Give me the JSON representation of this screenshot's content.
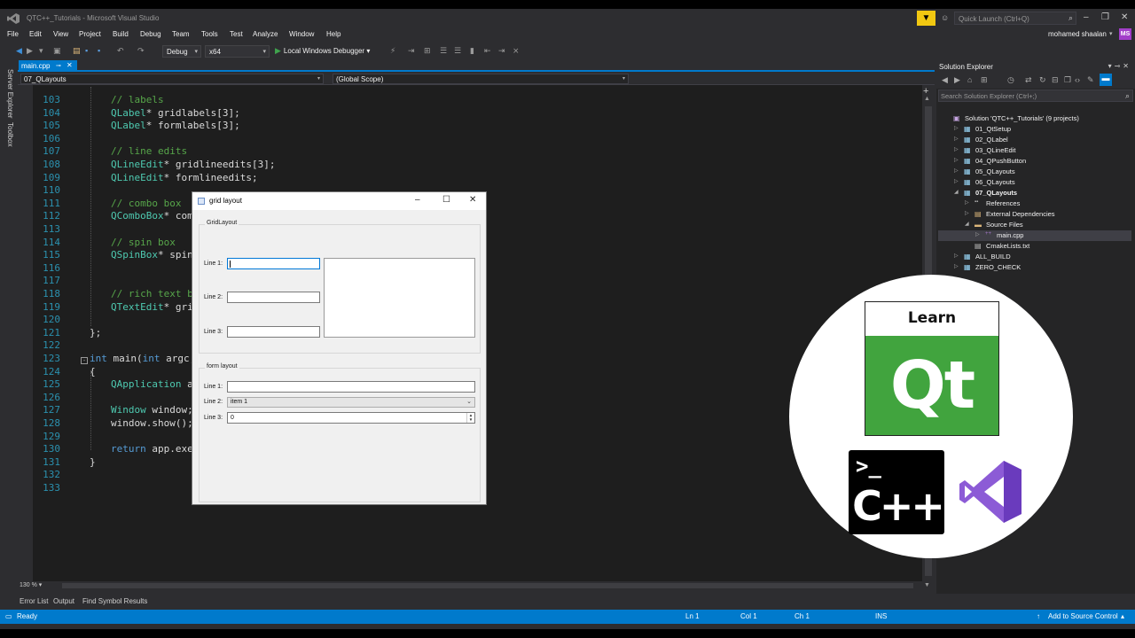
{
  "window": {
    "title": "QTC++_Tutorials - Microsoft Visual Studio",
    "quick_launch_placeholder": "Quick Launch (Ctrl+Q)",
    "user_name": "mohamed shaalan",
    "user_initials": "MS"
  },
  "menu": [
    "File",
    "Edit",
    "View",
    "Project",
    "Build",
    "Debug",
    "Team",
    "Tools",
    "Test",
    "Analyze",
    "Window",
    "Help"
  ],
  "toolbar": {
    "config": "Debug",
    "platform": "x64",
    "debugger": "Local Windows Debugger"
  },
  "side_tabs": [
    "Server Explorer",
    "Toolbox"
  ],
  "editor": {
    "tab_label": "main.cpp",
    "project_scope": "07_QLayouts",
    "scope": "(Global Scope)",
    "zoom": "130 %",
    "lines": [
      {
        "n": "103",
        "parts": [
          {
            "t": "// labels",
            "c": "cmt"
          }
        ]
      },
      {
        "n": "104",
        "parts": [
          {
            "t": "QLabel",
            "c": "ty"
          },
          {
            "t": "* gridlabels[3];",
            "c": "vr"
          }
        ]
      },
      {
        "n": "105",
        "parts": [
          {
            "t": "QLabel",
            "c": "ty"
          },
          {
            "t": "* formlabels[3];",
            "c": "vr"
          }
        ]
      },
      {
        "n": "106",
        "parts": []
      },
      {
        "n": "107",
        "parts": [
          {
            "t": "// line edits",
            "c": "cmt"
          }
        ]
      },
      {
        "n": "108",
        "parts": [
          {
            "t": "QLineEdit",
            "c": "ty"
          },
          {
            "t": "* gridlineedits[3];",
            "c": "vr"
          }
        ]
      },
      {
        "n": "109",
        "parts": [
          {
            "t": "QLineEdit",
            "c": "ty"
          },
          {
            "t": "* formlineedits;",
            "c": "vr"
          }
        ]
      },
      {
        "n": "110",
        "parts": []
      },
      {
        "n": "111",
        "parts": [
          {
            "t": "// combo box",
            "c": "cmt"
          }
        ]
      },
      {
        "n": "112",
        "parts": [
          {
            "t": "QComboBox",
            "c": "ty"
          },
          {
            "t": "* comb",
            "c": "vr"
          }
        ]
      },
      {
        "n": "113",
        "parts": []
      },
      {
        "n": "114",
        "parts": [
          {
            "t": "// spin box",
            "c": "cmt"
          }
        ]
      },
      {
        "n": "115",
        "parts": [
          {
            "t": "QSpinBox",
            "c": "ty"
          },
          {
            "t": "* spinb",
            "c": "vr"
          }
        ]
      },
      {
        "n": "116",
        "parts": []
      },
      {
        "n": "117",
        "parts": []
      },
      {
        "n": "118",
        "parts": [
          {
            "t": "// rich text bo",
            "c": "cmt"
          }
        ]
      },
      {
        "n": "119",
        "parts": [
          {
            "t": "QTextEdit",
            "c": "ty"
          },
          {
            "t": "* gri",
            "c": "vr"
          }
        ]
      },
      {
        "n": "120",
        "parts": []
      },
      {
        "n": "121",
        "parts": [
          {
            "t": "};",
            "c": "vr"
          }
        ]
      },
      {
        "n": "122",
        "parts": []
      },
      {
        "n": "123",
        "parts": [
          {
            "t": "int",
            "c": "kw"
          },
          {
            "t": " main(",
            "c": "vr"
          },
          {
            "t": "int",
            "c": "kw"
          },
          {
            "t": " argc,",
            "c": "vr"
          }
        ]
      },
      {
        "n": "124",
        "parts": [
          {
            "t": "{",
            "c": "vr"
          }
        ]
      },
      {
        "n": "125",
        "parts": [
          {
            "t": "QApplication",
            "c": "ty"
          },
          {
            "t": " ap",
            "c": "vr"
          }
        ]
      },
      {
        "n": "126",
        "parts": []
      },
      {
        "n": "127",
        "parts": [
          {
            "t": "Window",
            "c": "ty"
          },
          {
            "t": " window;",
            "c": "vr"
          }
        ]
      },
      {
        "n": "128",
        "parts": [
          {
            "t": "window.show();",
            "c": "vr"
          }
        ]
      },
      {
        "n": "129",
        "parts": []
      },
      {
        "n": "130",
        "parts": [
          {
            "t": "return",
            "c": "kw"
          },
          {
            "t": " app.exec",
            "c": "vr"
          }
        ]
      },
      {
        "n": "131",
        "parts": [
          {
            "t": "}",
            "c": "vr"
          }
        ]
      },
      {
        "n": "132",
        "parts": []
      },
      {
        "n": "133",
        "parts": []
      }
    ]
  },
  "bottom_tabs": [
    "Error List",
    "Output",
    "Find Symbol Results"
  ],
  "status": {
    "ready": "Ready",
    "ln": "Ln 1",
    "col": "Col 1",
    "ch": "Ch 1",
    "ins": "INS",
    "source_control": "Add to Source Control"
  },
  "solution_explorer": {
    "title": "Solution Explorer",
    "search_placeholder": "Search Solution Explorer (Ctrl+;)",
    "items": [
      {
        "label": "Solution 'QTC++_Tutorials' (9 projects)",
        "icon": "solution-icon",
        "bold": false
      },
      {
        "label": "01_QtSetup",
        "icon": "project-icon",
        "bold": false
      },
      {
        "label": "02_QLabel",
        "icon": "project-icon",
        "bold": false
      },
      {
        "label": "03_QLineEdit",
        "icon": "project-icon",
        "bold": false
      },
      {
        "label": "04_QPushButton",
        "icon": "project-icon",
        "bold": false
      },
      {
        "label": "05_QLayouts",
        "icon": "project-icon",
        "bold": false
      },
      {
        "label": "06_QLayouts",
        "icon": "project-icon",
        "bold": false
      },
      {
        "label": "07_QLayouts",
        "icon": "project-icon",
        "bold": true
      },
      {
        "label": "References",
        "icon": "references-icon",
        "bold": false
      },
      {
        "label": "External Dependencies",
        "icon": "external-deps-icon",
        "bold": false
      },
      {
        "label": "Source Files",
        "icon": "folder-icon",
        "bold": false
      },
      {
        "label": "main.cpp",
        "icon": "cpp-file-icon",
        "bold": false
      },
      {
        "label": "CmakeLists.txt",
        "icon": "text-file-icon",
        "bold": false
      },
      {
        "label": "ALL_BUILD",
        "icon": "project-icon",
        "bold": false
      },
      {
        "label": "ZERO_CHECK",
        "icon": "project-icon",
        "bold": false
      }
    ]
  },
  "qt_window": {
    "title": "grid layout",
    "grid_group_title": "GridLayout",
    "grid_labels": [
      "Line 1:",
      "Line 2:",
      "Line 3:"
    ],
    "form_group_title": "form layout",
    "form_labels": [
      "Line 1:",
      "Line 2:",
      "Line 3:"
    ],
    "combo_value": "item 1",
    "spin_value": "0"
  },
  "badge": {
    "learn": "Learn",
    "qt": "Qt",
    "cpp": "C++",
    "prompt": ">_"
  }
}
